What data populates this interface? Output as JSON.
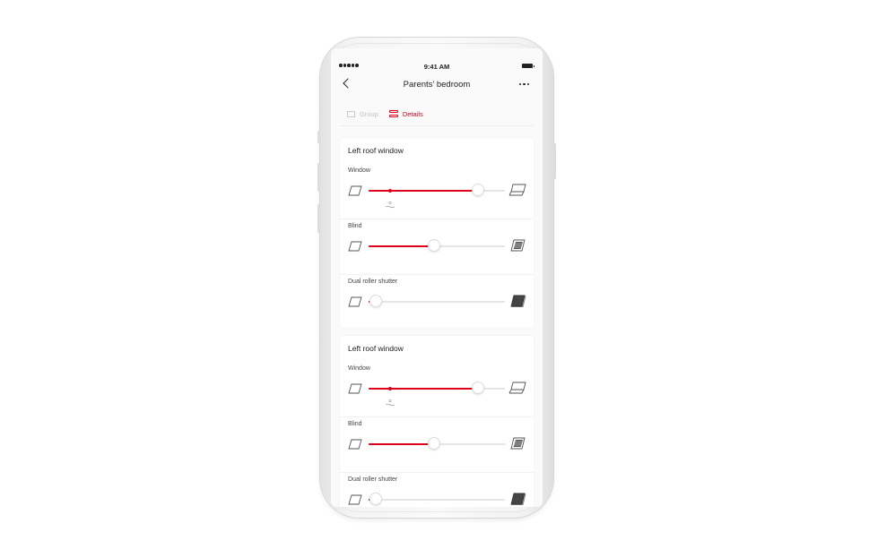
{
  "status_bar": {
    "time": "9:41 AM"
  },
  "nav": {
    "title": "Parents' bedroom"
  },
  "tabs": [
    {
      "label": "Group",
      "active": false,
      "icon": "group-icon"
    },
    {
      "label": "Details",
      "active": true,
      "icon": "details-icon"
    }
  ],
  "colors": {
    "accent": "#e1001a",
    "track": "#e6e6e6",
    "background": "#fafafa"
  },
  "cards": [
    {
      "title": "Left roof window",
      "rows": [
        {
          "label": "Window",
          "value_percent": 80,
          "rain_sensor_percent": 16,
          "icon_left": "window-closed-icon",
          "icon_right": "window-open-icon"
        },
        {
          "label": "Blind",
          "value_percent": 48,
          "icon_left": "window-closed-icon",
          "icon_right": "blind-closed-icon"
        },
        {
          "label": "Dual roller shutter",
          "value_percent": 5,
          "icon_left": "window-closed-icon",
          "icon_right": "shutter-closed-icon"
        }
      ]
    },
    {
      "title": "Left roof window",
      "rows": [
        {
          "label": "Window",
          "value_percent": 80,
          "rain_sensor_percent": 16,
          "icon_left": "window-closed-icon",
          "icon_right": "window-open-icon"
        },
        {
          "label": "Blind",
          "value_percent": 48,
          "icon_left": "window-closed-icon",
          "icon_right": "blind-closed-icon"
        },
        {
          "label": "Dual roller shutter",
          "value_percent": 5,
          "icon_left": "window-closed-icon",
          "icon_right": "shutter-closed-icon"
        }
      ]
    }
  ]
}
